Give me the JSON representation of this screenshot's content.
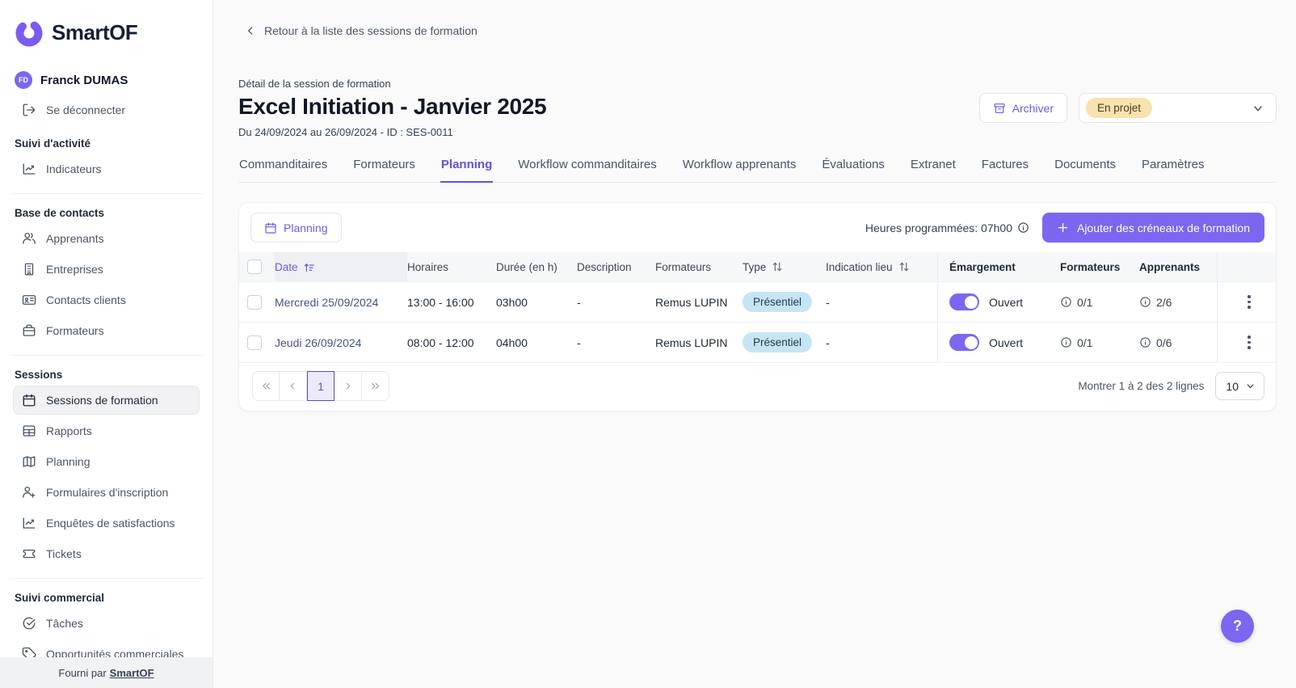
{
  "colors": {
    "accent": "#7C66F0",
    "tab_active": "#6A4FD8",
    "status_badge_bg": "#F8E2AE",
    "status_badge_text": "#473C28",
    "type_badge_bg": "#C6E5F3",
    "type_badge_text": "#1A3C52",
    "date_link": "#44538C"
  },
  "sidebar": {
    "logo_text": "SmartOF",
    "user": {
      "initials": "FD",
      "name": "Franck DUMAS"
    },
    "logout_label": "Se déconnecter",
    "sections": [
      {
        "label": "Suivi d'activité",
        "items": [
          {
            "label": "Indicateurs"
          }
        ]
      },
      {
        "label": "Base de contacts",
        "items": [
          {
            "label": "Apprenants"
          },
          {
            "label": "Entreprises"
          },
          {
            "label": "Contacts clients"
          },
          {
            "label": "Formateurs"
          }
        ]
      },
      {
        "label": "Sessions",
        "items": [
          {
            "label": "Sessions de formation",
            "active": true
          },
          {
            "label": "Rapports"
          },
          {
            "label": "Planning"
          },
          {
            "label": "Formulaires d'inscription"
          },
          {
            "label": "Enquêtes de satisfactions"
          },
          {
            "label": "Tickets"
          }
        ]
      },
      {
        "label": "Suivi commercial",
        "items": [
          {
            "label": "Tâches"
          },
          {
            "label": "Opportunités commerciales"
          }
        ]
      }
    ],
    "footer_prefix": "Fourni par",
    "footer_brand": "SmartOF"
  },
  "header": {
    "back_link": "Retour à la liste des sessions de formation",
    "eyebrow": "Détail de la session de formation",
    "title": "Excel Initiation - Janvier 2025",
    "subtitle": "Du 24/09/2024 au 26/09/2024 - ID : SES-0011",
    "archive_button": "Archiver",
    "status_value": "En projet"
  },
  "tabs": [
    {
      "label": "Commanditaires"
    },
    {
      "label": "Formateurs"
    },
    {
      "label": "Planning",
      "active": true
    },
    {
      "label": "Workflow commanditaires"
    },
    {
      "label": "Workflow apprenants"
    },
    {
      "label": "Évaluations"
    },
    {
      "label": "Extranet"
    },
    {
      "label": "Factures"
    },
    {
      "label": "Documents"
    },
    {
      "label": "Paramètres"
    }
  ],
  "planning": {
    "view_button": "Planning",
    "hours_summary": "Heures programmées: 07h00",
    "add_button": "Ajouter des créneaux de formation",
    "table": {
      "headers": {
        "date": "Date",
        "horaires": "Horaires",
        "duree": "Durée (en h)",
        "description": "Description",
        "formateurs": "Formateurs",
        "type": "Type",
        "indication_lieu": "Indication lieu",
        "emargement": "Émargement",
        "formateurs_count": "Formateurs",
        "apprenants": "Apprenants"
      },
      "rows": [
        {
          "date": "Mercredi 25/09/2024",
          "horaires": "13:00 - 16:00",
          "duree": "03h00",
          "description": "-",
          "formateurs": "Remus LUPIN",
          "type": "Présentiel",
          "indication_lieu": "-",
          "emargement_state": "Ouvert",
          "formateurs_count": "0/1",
          "apprenants_count": "2/6"
        },
        {
          "date": "Jeudi 26/09/2024",
          "horaires": "08:00 - 12:00",
          "duree": "04h00",
          "description": "-",
          "formateurs": "Remus LUPIN",
          "type": "Présentiel",
          "indication_lieu": "-",
          "emargement_state": "Ouvert",
          "formateurs_count": "0/1",
          "apprenants_count": "0/6"
        }
      ]
    },
    "pagination": {
      "current_page": "1",
      "summary": "Montrer 1 à 2 des 2 lignes",
      "page_size": "10"
    }
  },
  "help_button": "?"
}
